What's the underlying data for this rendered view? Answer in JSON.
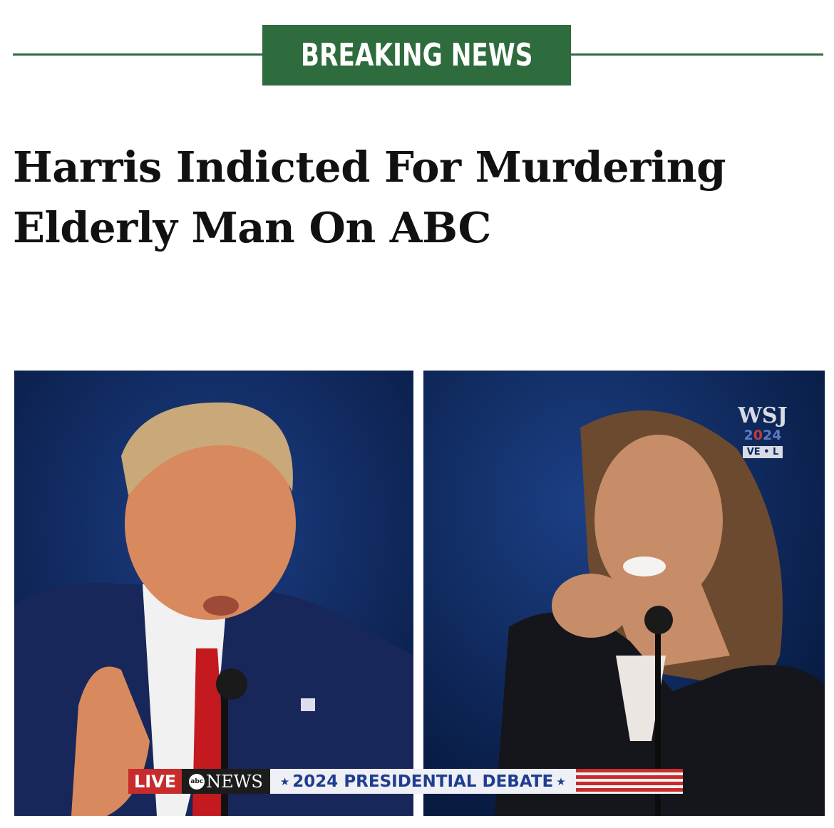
{
  "banner": {
    "label": "BREAKING NEWS",
    "color": "#2e6b3d"
  },
  "headline": {
    "line1": "Harris Indicted For Murdering",
    "line2": "Elderly Man On ABC"
  },
  "photo": {
    "watermark": {
      "logo": "WSJ",
      "year_a": "2",
      "year_o": "0",
      "year_b": "24",
      "tag": "VE • L"
    },
    "ticker": {
      "live": "LIVE",
      "network_mark": "abc",
      "network": "NEWS",
      "star_left": "★",
      "title": "2024 PRESIDENTIAL DEBATE",
      "star_right": "★"
    }
  }
}
